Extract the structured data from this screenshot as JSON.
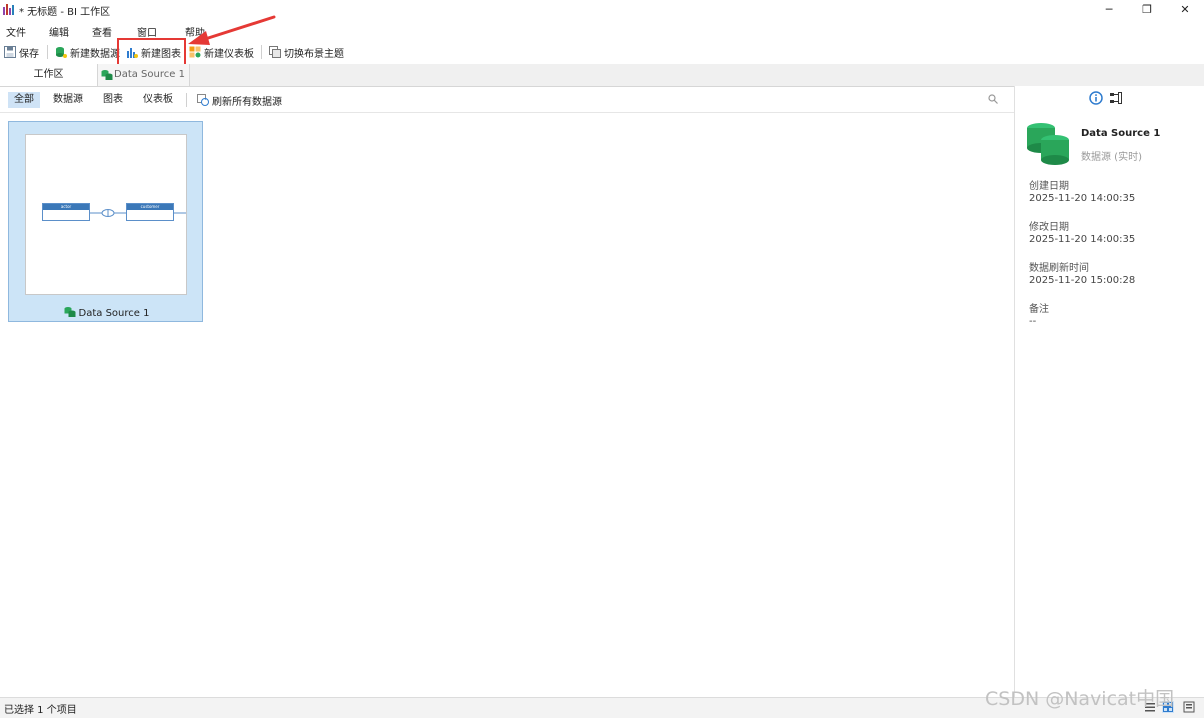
{
  "window": {
    "title": "* 无标题 - BI 工作区",
    "controls": [
      "─",
      "❐",
      "✕"
    ]
  },
  "menu": [
    "文件",
    "编辑",
    "查看",
    "窗口",
    "帮助"
  ],
  "toolbar": {
    "save": "保存",
    "new_datasource": "新建数据源",
    "new_chart": "新建图表",
    "new_dashboard": "新建仪表板",
    "switch_theme": "切换布景主题"
  },
  "tabs": {
    "workspace": "工作区",
    "datasource": "Data Source 1"
  },
  "filters": {
    "all": "全部",
    "datasource": "数据源",
    "chart": "图表",
    "dashboard": "仪表板",
    "refresh_all": "刷新所有数据源"
  },
  "card": {
    "label": "Data Source 1",
    "thumb_nodes": [
      "actor",
      "customer"
    ]
  },
  "side": {
    "name": "Data Source 1",
    "type": "数据源 (实时)",
    "created_label": "创建日期",
    "created_value": "2025-11-20 14:00:35",
    "modified_label": "修改日期",
    "modified_value": "2025-11-20 14:00:35",
    "refreshed_label": "数据刷新时间",
    "refreshed_value": "2025-11-20 15:00:28",
    "note_label": "备注",
    "note_value": "--"
  },
  "status": {
    "text": "已选择 1 个项目"
  },
  "watermark": "CSDN @Navicat中国",
  "colors": {
    "accent": "#2f7ccf",
    "selection": "#cce4f7",
    "annotation": "#e53935",
    "datasource_green": "#2aa65a"
  }
}
